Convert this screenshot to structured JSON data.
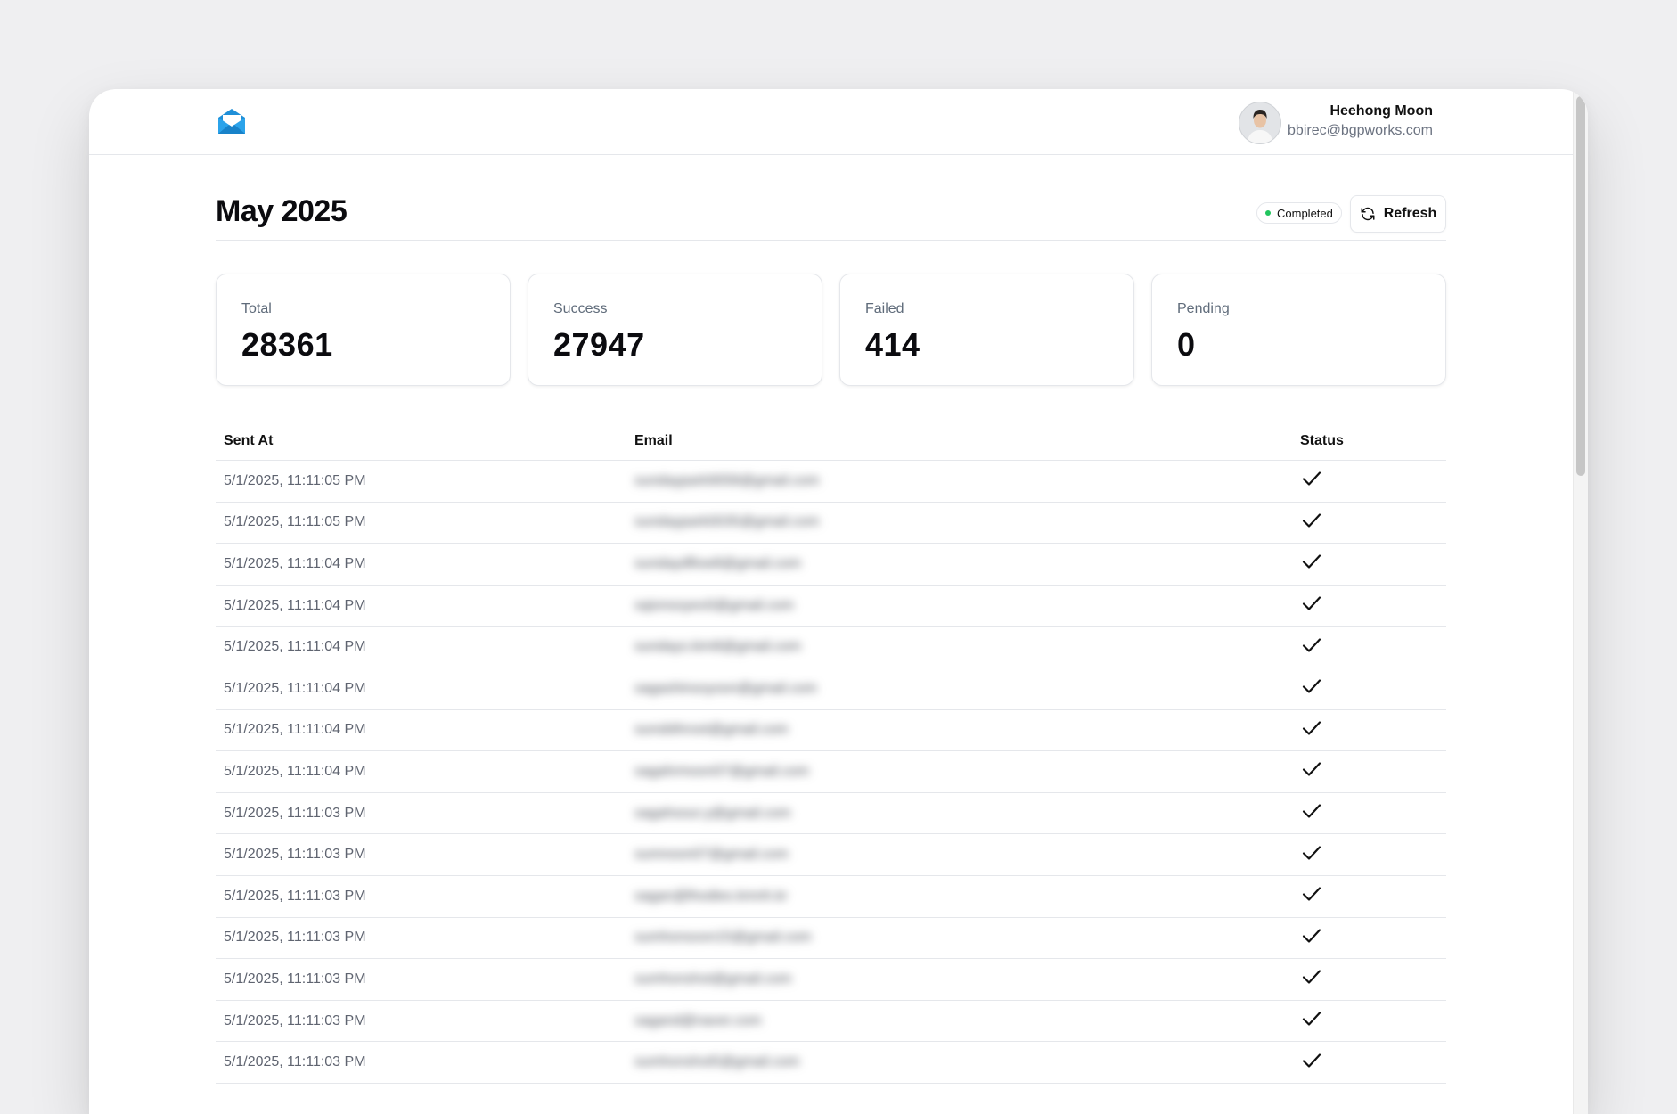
{
  "user": {
    "name": "Heehong Moon",
    "email": "bbirec@bgpworks.com"
  },
  "page": {
    "title": "May 2025",
    "status": "Completed",
    "refresh_label": "Refresh"
  },
  "stats": [
    {
      "label": "Total",
      "value": "28361"
    },
    {
      "label": "Success",
      "value": "27947"
    },
    {
      "label": "Failed",
      "value": "414"
    },
    {
      "label": "Pending",
      "value": "0"
    }
  ],
  "table": {
    "headers": {
      "sent_at": "Sent At",
      "email": "Email",
      "status": "Status"
    },
    "rows": [
      {
        "sent_at": "5/1/2025, 11:11:05 PM",
        "email": "sundaypark9058@gmail.com",
        "status": "success"
      },
      {
        "sent_at": "5/1/2025, 11:11:05 PM",
        "email": "sundaypark0035@gmail.com",
        "status": "success"
      },
      {
        "sent_at": "5/1/2025, 11:11:04 PM",
        "email": "sundaydflow8@gmail.com",
        "status": "success"
      },
      {
        "sent_at": "5/1/2025, 11:11:04 PM",
        "email": "sqionsoyeo0@gmail.com",
        "status": "success"
      },
      {
        "sent_at": "5/1/2025, 11:11:04 PM",
        "email": "sundays.kim8@gmail.com",
        "status": "success"
      },
      {
        "sent_at": "5/1/2025, 11:11:04 PM",
        "email": "sagashinsoyoon@gmail.com",
        "status": "success"
      },
      {
        "sent_at": "5/1/2025, 11:11:04 PM",
        "email": "sunsbthroot@gmail.com",
        "status": "success"
      },
      {
        "sent_at": "5/1/2025, 11:11:04 PM",
        "email": "sagahrmoon07@gmail.com",
        "status": "success"
      },
      {
        "sent_at": "5/1/2025, 11:11:03 PM",
        "email": "sagahsour.y@gmail.com",
        "status": "success"
      },
      {
        "sent_at": "5/1/2025, 11:11:03 PM",
        "email": "sumnoon07@gmail.com",
        "status": "success"
      },
      {
        "sent_at": "5/1/2025, 11:11:03 PM",
        "email": "sagan@lhodies.kmnh.kr",
        "status": "success"
      },
      {
        "sent_at": "5/1/2025, 11:11:03 PM",
        "email": "sumhonsoon15@gmail.com",
        "status": "success"
      },
      {
        "sent_at": "5/1/2025, 11:11:03 PM",
        "email": "sumhonshot@gmail.com",
        "status": "success"
      },
      {
        "sent_at": "5/1/2025, 11:11:03 PM",
        "email": "sagand@naver.com",
        "status": "success"
      },
      {
        "sent_at": "5/1/2025, 11:11:03 PM",
        "email": "sumhonshot5@gmail.com",
        "status": "success"
      }
    ]
  },
  "colors": {
    "status_dot": "#22c55e",
    "logo_blue": "#1f8fd8",
    "background": "#efeff1"
  }
}
